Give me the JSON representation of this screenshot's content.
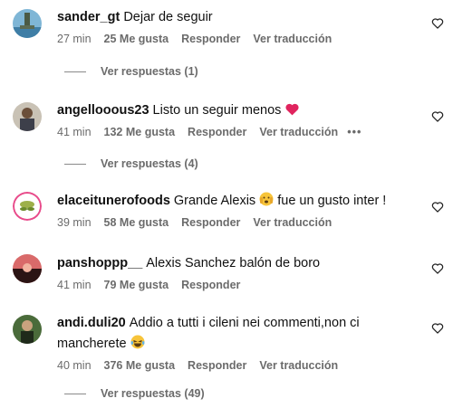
{
  "comments": [
    {
      "username": "sander_gt",
      "text": "Dejar de seguir",
      "time": "27 min",
      "likes": "25 Me gusta",
      "reply_label": "Responder",
      "translate_label": "Ver traducción",
      "replies_label": "Ver respuestas (1)"
    },
    {
      "username": "angellooous23",
      "text": "Listo un seguir menos",
      "emoji": "red-heart-icon",
      "time": "41 min",
      "likes": "132 Me gusta",
      "reply_label": "Responder",
      "translate_label": "Ver traducción",
      "more_label": "•••",
      "replies_label": "Ver respuestas (4)"
    },
    {
      "username": "elaceitunerofoods",
      "text_before": "Grande Alexis",
      "emoji": "crying-face-icon",
      "text_after": "fue un gusto inter !",
      "time": "39 min",
      "likes": "58 Me gusta",
      "reply_label": "Responder",
      "translate_label": "Ver traducción"
    },
    {
      "username": "panshoppp__",
      "text": "Alexis Sanchez balón de boro",
      "time": "41 min",
      "likes": "79 Me gusta",
      "reply_label": "Responder"
    },
    {
      "username": "andi.duli20",
      "text": "Addio a tutti i cileni nei commenti,non ci mancherete",
      "emoji": "laughing-tears-icon",
      "time": "40 min",
      "likes": "376 Me gusta",
      "reply_label": "Responder",
      "translate_label": "Ver traducción",
      "replies_label": "Ver respuestas (49)"
    }
  ],
  "colors": {
    "meta": "#6b6b6b",
    "heart_emoji": "#e0245e"
  }
}
